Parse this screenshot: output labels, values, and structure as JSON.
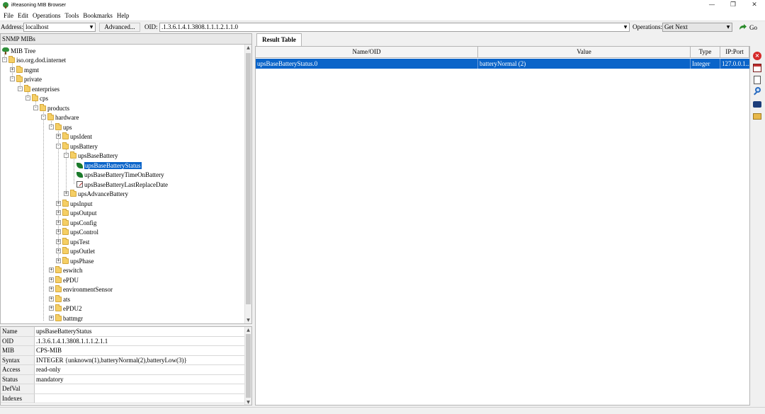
{
  "window": {
    "title": "iReasoning MIB Browser",
    "controls": {
      "minimize": "—",
      "maximize": "❐",
      "close": "✕"
    }
  },
  "menu": [
    "File",
    "Edit",
    "Operations",
    "Tools",
    "Bookmarks",
    "Help"
  ],
  "toolbar": {
    "address_label": "Address:",
    "address_value": "localhost",
    "advanced_label": "Advanced...",
    "oid_label": "OID:",
    "oid_value": ".1.3.6.1.4.1.3808.1.1.1.2.1.1.0",
    "operations_label": "Operations:",
    "operation_value": "Get Next",
    "go_label": "Go"
  },
  "left_panel": {
    "header": "SNMP MIBs",
    "tree": [
      {
        "label": "MIB Tree"
      },
      {
        "label": "iso.org.dod.internet"
      },
      {
        "label": "mgmt"
      },
      {
        "label": "private"
      },
      {
        "label": "enterprises"
      },
      {
        "label": "cps"
      },
      {
        "label": "products"
      },
      {
        "label": "hardware"
      },
      {
        "label": "ups"
      },
      {
        "label": "upsIdent"
      },
      {
        "label": "upsBattery"
      },
      {
        "label": "upsBaseBattery"
      },
      {
        "label": "upsBaseBatteryStatus",
        "selected": true
      },
      {
        "label": "upsBaseBatteryTimeOnBattery"
      },
      {
        "label": "upsBaseBatteryLastReplaceDate"
      },
      {
        "label": "upsAdvanceBattery"
      },
      {
        "label": "upsInput"
      },
      {
        "label": "upsOutput"
      },
      {
        "label": "upsConfig"
      },
      {
        "label": "upsControl"
      },
      {
        "label": "upsTest"
      },
      {
        "label": "upsOutlet"
      },
      {
        "label": "upsPhase"
      },
      {
        "label": "eswitch"
      },
      {
        "label": "ePDU"
      },
      {
        "label": "environmentSensor"
      },
      {
        "label": "ats"
      },
      {
        "label": "ePDU2"
      },
      {
        "label": "battmgr"
      }
    ]
  },
  "properties": [
    {
      "key": "Name",
      "value": "upsBaseBatteryStatus"
    },
    {
      "key": "OID",
      "value": ".1.3.6.1.4.1.3808.1.1.1.2.1.1"
    },
    {
      "key": "MIB",
      "value": "CPS-MIB"
    },
    {
      "key": "Syntax",
      "value": "INTEGER {unknown(1),batteryNormal(2),batteryLow(3)}"
    },
    {
      "key": "Access",
      "value": "read-only"
    },
    {
      "key": "Status",
      "value": "mandatory"
    },
    {
      "key": "DefVal",
      "value": ""
    },
    {
      "key": "Indexes",
      "value": ""
    }
  ],
  "result": {
    "tab": "Result Table",
    "columns": [
      "Name/OID",
      "Value",
      "Type",
      "IP:Port"
    ],
    "rows": [
      {
        "name": "upsBaseBatteryStatus.0",
        "value": "batteryNormal (2)",
        "type": "Integer",
        "ip": "127.0.0.1..."
      }
    ]
  },
  "side_tools": [
    "stop-icon",
    "table-icon",
    "document-icon",
    "find-icon",
    "camera-icon",
    "open-folder-icon"
  ],
  "colors": {
    "selection": "#0a64c9",
    "folder": "#f5cf66",
    "leaf": "#1b7a2b"
  }
}
